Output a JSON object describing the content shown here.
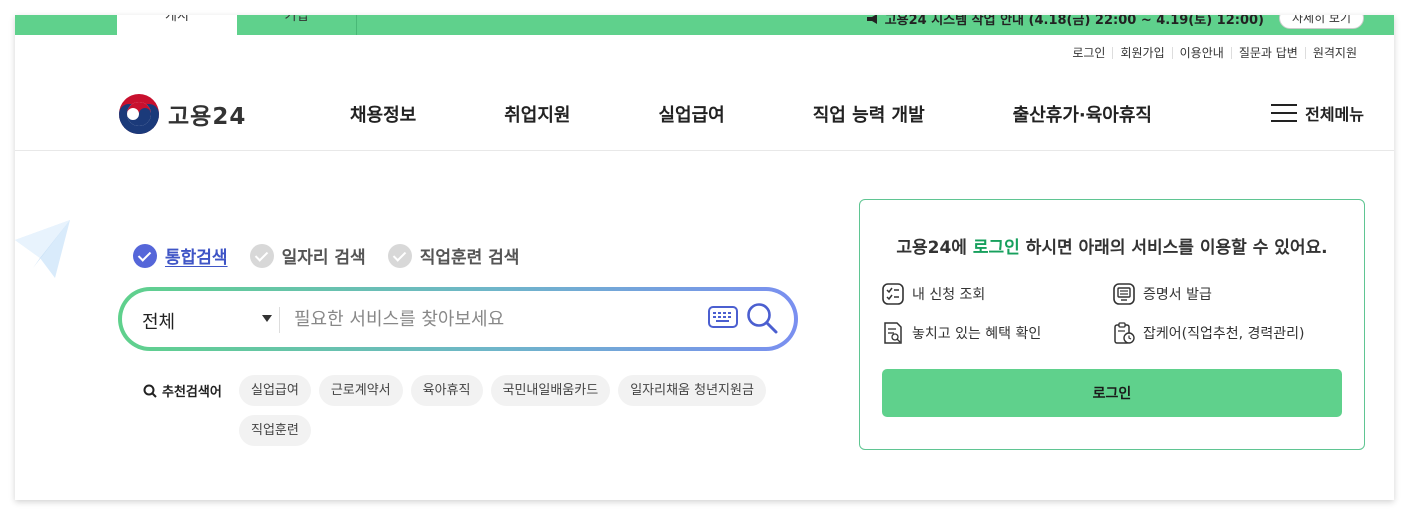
{
  "notice": {
    "tab_active": "게시",
    "tab_inactive": "기업",
    "text": "고용24 시스템 작업 안내 (4.18(금) 22:00 ~ 4.19(토) 12:00)",
    "detail_button": "자세히 보기"
  },
  "util_links": [
    "로그인",
    "회원가입",
    "이용안내",
    "질문과 답변",
    "원격지원"
  ],
  "logo": {
    "text": "고용24"
  },
  "gnb": [
    "채용정보",
    "취업지원",
    "실업급여",
    "직업 능력 개발",
    "출산휴가·육아휴직"
  ],
  "allmenu": {
    "label": "전체메뉴"
  },
  "search_types": [
    {
      "label": "통합검색",
      "active": true
    },
    {
      "label": "일자리 검색",
      "active": false
    },
    {
      "label": "직업훈련 검색",
      "active": false
    }
  ],
  "search": {
    "select_value": "전체",
    "placeholder": "필요한 서비스를 찾아보세요"
  },
  "recommend": {
    "label": "추천검색어",
    "tags": [
      "실업급여",
      "근로계약서",
      "육아휴직",
      "국민내일배움카드",
      "일자리채움 청년지원금",
      "직업훈련"
    ]
  },
  "login_box": {
    "title_pre": "고용24에 ",
    "title_hl": "로그인",
    "title_post": " 하시면 아래의 서비스를 이용할 수 있어요.",
    "services": [
      "내 신청 조회",
      "증명서 발급",
      "놓치고 있는 혜택 확인",
      "잡케어(직업추천, 경력관리)"
    ],
    "button": "로그인"
  },
  "colors": {
    "brand_green": "#5fd18c",
    "highlight_green": "#17a05d",
    "search_active_blue": "#3f55c6"
  }
}
